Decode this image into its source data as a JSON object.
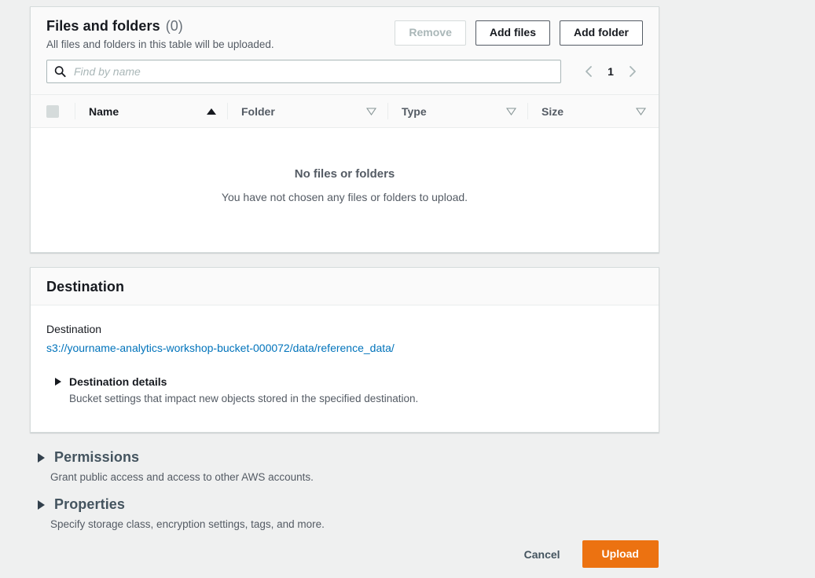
{
  "files_panel": {
    "title": "Files and folders",
    "count": "(0)",
    "subtitle": "All files and folders in this table will be uploaded.",
    "buttons": {
      "remove": "Remove",
      "add_files": "Add files",
      "add_folder": "Add folder"
    },
    "search": {
      "placeholder": "Find by name",
      "value": "",
      "icon": "search-icon"
    },
    "pagination": {
      "prev_icon": "chevron-left-icon",
      "next_icon": "chevron-right-icon",
      "current_page": "1"
    },
    "table": {
      "columns": [
        {
          "label": "Name",
          "sort_icon": "sort-ascending-icon",
          "sorted": true
        },
        {
          "label": "Folder",
          "sort_icon": "sort-descending-icon",
          "sorted": false
        },
        {
          "label": "Type",
          "sort_icon": "sort-descending-icon",
          "sorted": false
        },
        {
          "label": "Size",
          "sort_icon": "sort-descending-icon",
          "sorted": false
        }
      ],
      "select_all_checkbox": {
        "checked": false,
        "disabled": true
      },
      "rows": [],
      "empty_title": "No files or folders",
      "empty_subtitle": "You have not chosen any files or folders to upload."
    }
  },
  "destination_panel": {
    "header_title": "Destination",
    "field_label": "Destination",
    "destination_uri": "s3://yourname-analytics-workshop-bucket-000072/data/reference_data/",
    "details_expander": {
      "icon": "triangle-right-icon",
      "title": "Destination details",
      "description": "Bucket settings that impact new objects stored in the specified destination.",
      "expanded": false
    }
  },
  "permissions_section": {
    "icon": "triangle-right-icon",
    "title": "Permissions",
    "description": "Grant public access and access to other AWS accounts.",
    "expanded": false
  },
  "properties_section": {
    "icon": "triangle-right-icon",
    "title": "Properties",
    "description": "Specify storage class, encryption settings, tags, and more.",
    "expanded": false
  },
  "footer": {
    "cancel_label": "Cancel",
    "upload_label": "Upload"
  },
  "colors": {
    "accent_orange": "#ec7211",
    "link_blue": "#0073bb",
    "page_background": "#eff0f0",
    "card_header_background": "#fafafa",
    "border": "#d5dbdb"
  }
}
